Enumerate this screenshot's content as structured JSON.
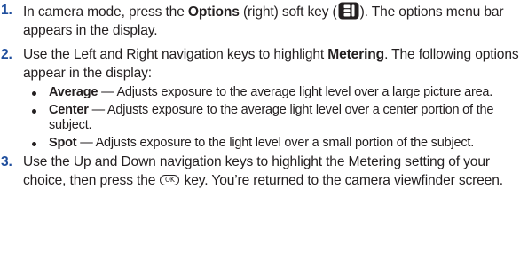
{
  "steps": [
    {
      "number": "1.",
      "text_before": "In camera mode, press the ",
      "bold": "Options",
      "text_mid": " (right) soft key (",
      "icon": "options-softkey-icon",
      "text_after": "). The options menu bar appears in the display."
    },
    {
      "number": "2.",
      "text_before": "Use the Left and Right navigation keys to highlight ",
      "bold": "Metering",
      "text_after": ". The following options appear in the display:",
      "bullets": [
        {
          "term": "Average",
          "desc": " — Adjusts exposure to the average light level over a large picture area."
        },
        {
          "term": "Center",
          "desc": " — Adjusts exposure to the average light level over a center portion of the subject."
        },
        {
          "term": "Spot",
          "desc": " — Adjusts exposure to the light level over a small portion of the subject."
        }
      ]
    },
    {
      "number": "3.",
      "text_before": "Use the Up and Down navigation keys to highlight the Metering setting of your choice, then press the ",
      "icon": "ok-key-icon",
      "icon_label": "OK",
      "text_after": " key. You’re returned to the camera viewfinder screen."
    }
  ],
  "colors": {
    "step_number": "#1f4e9d",
    "text": "#231f20"
  }
}
